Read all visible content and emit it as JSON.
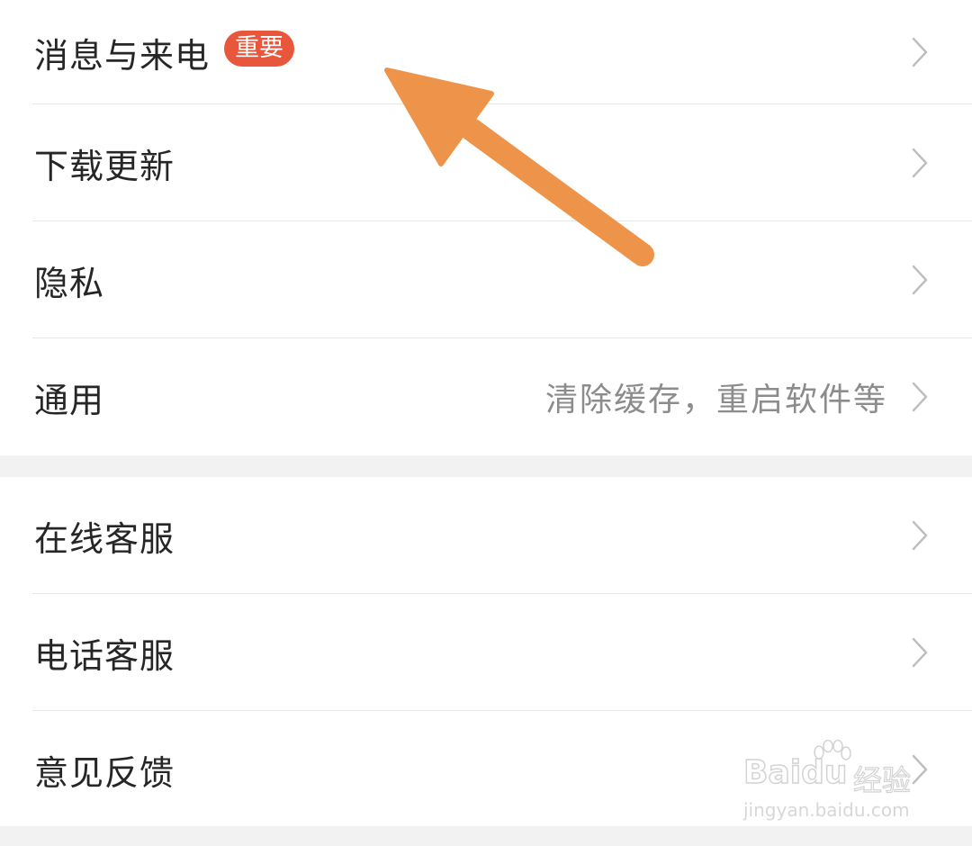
{
  "settings": {
    "group1": [
      {
        "label": "消息与来电",
        "badge": "重要"
      },
      {
        "label": "下载更新"
      },
      {
        "label": "隐私"
      },
      {
        "label": "通用",
        "subtext": "清除缓存，重启软件等"
      }
    ],
    "group2": [
      {
        "label": "在线客服"
      },
      {
        "label": "电话客服"
      },
      {
        "label": "意见反馈"
      }
    ]
  },
  "watermark": {
    "brand": "Baidu",
    "brand_cn": "经验",
    "url": "jingyan.baidu.com"
  },
  "colors": {
    "badge": "#e8573c",
    "annotation_arrow": "#ee944a",
    "text_primary": "#262626",
    "text_secondary": "#8c8c8c",
    "chevron": "#bdbdbd"
  },
  "icons": {
    "row_chevron": "chevron-right-icon",
    "annotation": "arrow-annotation-icon"
  }
}
